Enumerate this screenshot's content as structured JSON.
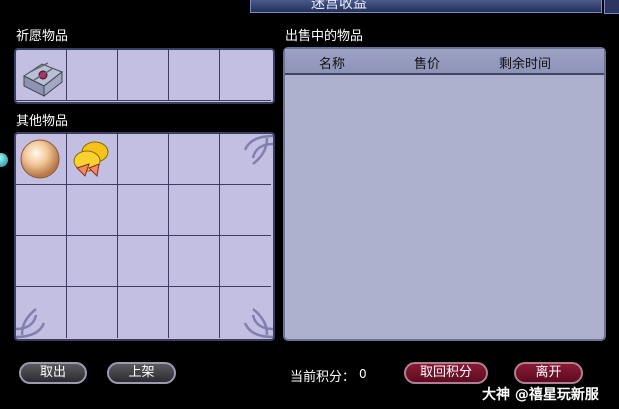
{
  "window": {
    "title": "迷宫收益"
  },
  "wish": {
    "label": "祈愿物品",
    "slot_count": 5,
    "first_item_icon": "treasure-chest-icon"
  },
  "other": {
    "label": "其他物品",
    "rows": 4,
    "cols": 5,
    "items": [
      "pearl-icon",
      "gold-coins-icon"
    ]
  },
  "sale": {
    "label": "出售中的物品",
    "columns": [
      "名称",
      "售价",
      "剩余时间"
    ]
  },
  "buttons": {
    "take_out": "取出",
    "list_item": "上架",
    "redeem_points": "取回积分",
    "leave": "离开"
  },
  "points": {
    "label": "当前积分：",
    "value": "0"
  },
  "watermark": {
    "brand": "大神",
    "handle": "@禧星玩新服"
  },
  "colors": {
    "slot_bg": "#c3bfe3",
    "sale_bg": "#aeb1cd",
    "red_button": "#7a1530"
  }
}
